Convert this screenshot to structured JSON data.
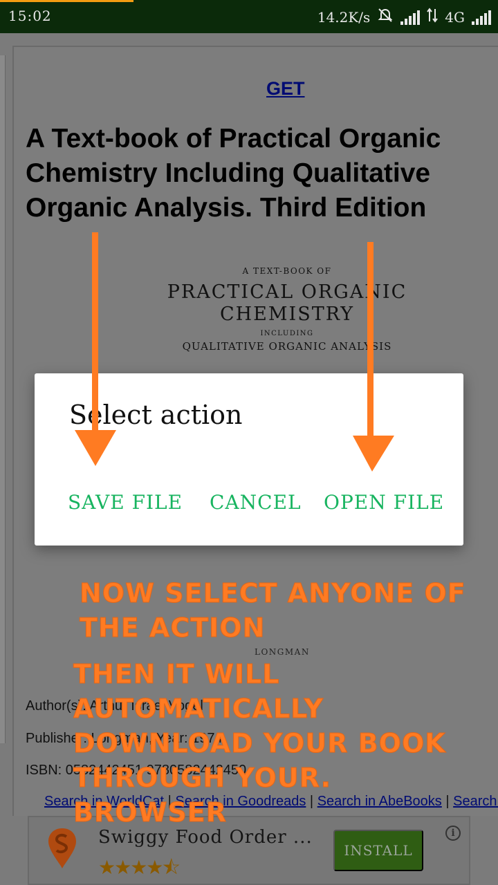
{
  "status_bar": {
    "time": "15:02",
    "network_speed": "14.2K/s",
    "network_type": "4G",
    "icons": [
      "mute-icon",
      "signal-icon",
      "data-arrows-icon",
      "signal-icon"
    ]
  },
  "page": {
    "get_link": "GET",
    "book_title": "A Text-book of Practical Organic Chemistry Including Qualitative Organic Analysis. Third Edition",
    "cover": {
      "line1": "A TEXT-BOOK OF",
      "line2": "PRACTICAL ORGANIC",
      "line3": "CHEMISTRY",
      "line4": "INCLUDING",
      "line5": "QUALITATIVE ORGANIC ANALYSIS",
      "publisher_mark": "LONGMAN"
    },
    "author_line": "Author(s): Arthur Israel Vogel",
    "publisher_line": "Publisher: Longman, Year: 1974",
    "isbn_line": "ISBN: 0582442451 9780582442450",
    "search_links": [
      "Search in WorldCat",
      "Search in Goodreads",
      "Search in AbeBooks",
      "Search in Amazon"
    ],
    "separator": " | "
  },
  "dialog": {
    "title": "Select action",
    "save_label": "SAVE FILE",
    "cancel_label": "CANCEL",
    "open_label": "OPEN FILE"
  },
  "annotations": {
    "text1": "NOW SELECT ANYONE OF THE ACTION",
    "text2": "THEN IT WILL AUTOMATICALLY DOWNLOAD YOUR BOOK THROUGH YOUR. BROWSER",
    "color": "#ff7b22"
  },
  "ad": {
    "app_name": "Swiggy Food Order ...",
    "rating_stars": "★★★★⯪",
    "install_label": "INSTALL",
    "info_label": "i",
    "logo_icon": "swiggy-logo-icon"
  },
  "colors": {
    "status_bar_bg": "#0b2a0a",
    "dialog_button": "#18b460",
    "install_bg": "#2f5d13",
    "link": "#000b73"
  }
}
